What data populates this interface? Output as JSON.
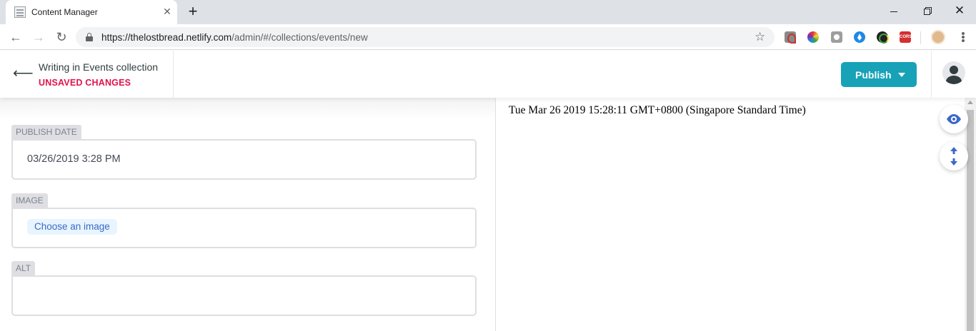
{
  "browser": {
    "tab_title": "Content Manager",
    "url_host": "https://thelostbread.netlify.com",
    "url_path": "/admin/#/collections/events/new",
    "extensions": [
      "pdf-icon",
      "color-picker-icon",
      "camera-icon",
      "dropper-icon",
      "ring-icon",
      "cors-icon"
    ],
    "cors_label": "CORS"
  },
  "header": {
    "title": "Writing in Events collection",
    "status": "UNSAVED CHANGES",
    "status_color": "#e0134d",
    "publish_label": "Publish",
    "publish_color": "#17a2b8"
  },
  "fields": [
    {
      "label": "PUBLISH DATE",
      "value": "03/26/2019 3:28 PM"
    },
    {
      "label": "IMAGE",
      "button": "Choose an image"
    },
    {
      "label": "ALT",
      "value": ""
    }
  ],
  "preview": {
    "text": "Tue Mar 26 2019 15:28:11 GMT+0800 (Singapore Standard Time)"
  }
}
